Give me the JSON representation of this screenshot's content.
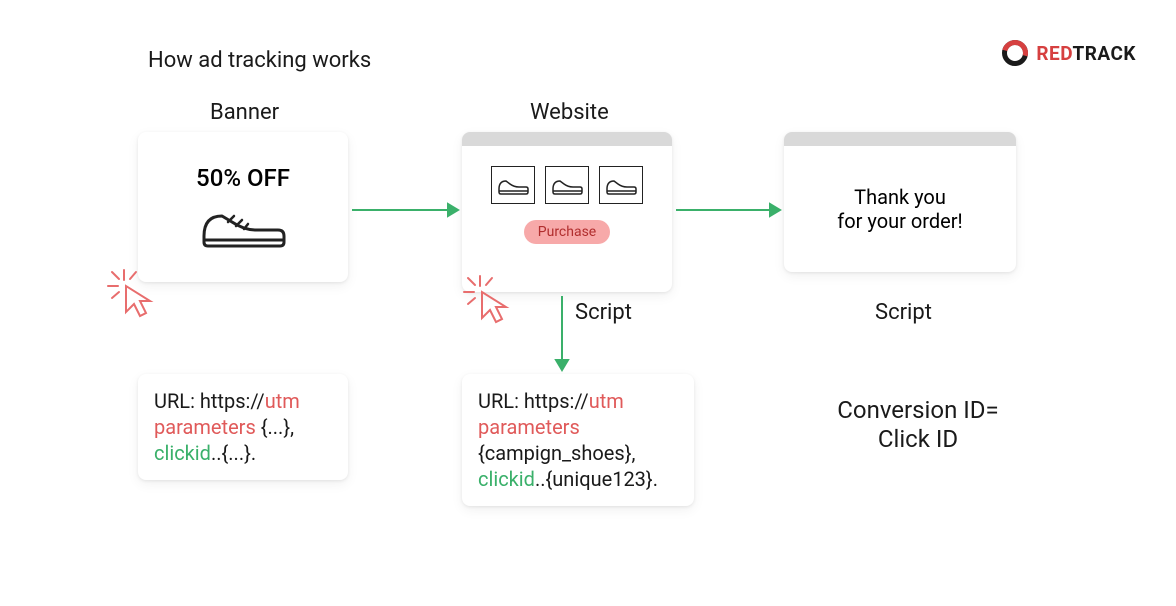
{
  "title": "How ad tracking works",
  "logo": {
    "red": "RED",
    "rest": "TRACK"
  },
  "labels": {
    "banner": "Banner",
    "website": "Website",
    "script1": "Script",
    "script2": "Script"
  },
  "banner": {
    "offer": "50% OFF"
  },
  "website": {
    "purchase_label": "Purchase"
  },
  "thankyou": {
    "line1": "Thank you",
    "line2": "for your order!"
  },
  "url1": {
    "prefix": "URL: https://",
    "red": "utm parameters",
    "mid1": " {...},",
    "green": "clickid",
    "mid2": "..{...}."
  },
  "url2": {
    "prefix": "URL: https://",
    "red": "utm parameters",
    "mid1": " {campign_shoes}, ",
    "green": "clickid",
    "mid2": "..{unique123}."
  },
  "conversion": {
    "line1": "Conversion ID=",
    "line2": "Click ID"
  }
}
